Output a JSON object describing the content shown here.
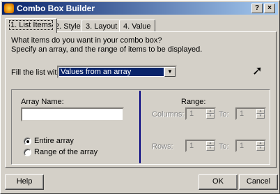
{
  "window": {
    "title": "Combo Box Builder",
    "help_glyph": "?",
    "close_glyph": "×"
  },
  "tabs": [
    {
      "label": "1. List Items",
      "active": true
    },
    {
      "label": "2. Style"
    },
    {
      "label": "3. Layout"
    },
    {
      "label": "4. Value"
    }
  ],
  "page": {
    "prompt_line1": "What items do you want in your combo box?",
    "prompt_line2": "Specify an array, and the range of items to be displayed.",
    "fill_label": "Fill the list with:",
    "fill_value": "Values from an array",
    "array_name_label": "Array Name:",
    "array_name_value": "",
    "radio_entire": "Entire array",
    "radio_range": "Range of the array",
    "range_label": "Range:",
    "columns_label": "Columns:",
    "rows_label": "Rows:",
    "to_label": "To:",
    "columns_from": "1",
    "columns_to": "1",
    "rows_from": "1",
    "rows_to": "1"
  },
  "buttons": {
    "help": "Help",
    "ok": "OK",
    "cancel": "Cancel"
  }
}
